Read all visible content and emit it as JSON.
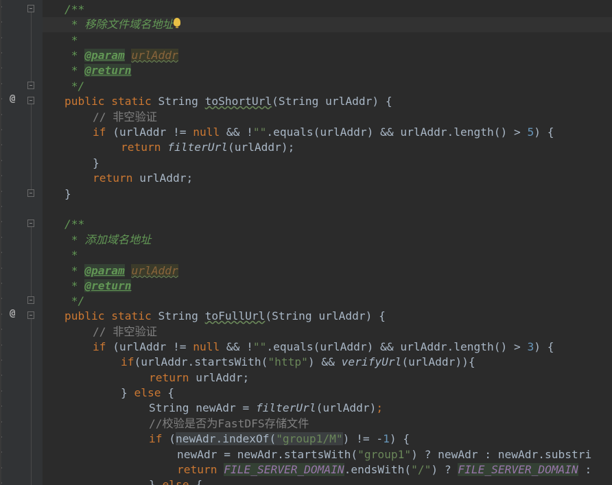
{
  "editor": {
    "lines": {
      "l1": "/**",
      "l2": " * 移除文件域名地址",
      "l3": " *",
      "l4_star": " * ",
      "l4_tag": "@param",
      "l4_name": "urlAddr",
      "l5_star": " * ",
      "l5_tag": "@return",
      "l6": " */",
      "l7_kw": "public static",
      "l7_type": " String ",
      "l7_name": "toShortUrl",
      "l7_rest": "(String urlAddr) {",
      "l8": "// 非空验证",
      "l9_kw1": "if",
      "l9_a": " (urlAddr != ",
      "l9_kw2": "null",
      "l9_b": " && !",
      "l9_str": "\"\"",
      "l9_c": ".equals(urlAddr) && urlAddr.length() > ",
      "l9_num": "5",
      "l9_d": ") {",
      "l10_kw": "return",
      "l10_fn": " filterUrl",
      "l10_rest": "(urlAddr);",
      "l11": "}",
      "l12_kw": "return",
      "l12_rest": " urlAddr;",
      "l13": "}",
      "l15": "/**",
      "l16": " * 添加域名地址",
      "l17": " *",
      "l18_star": " * ",
      "l18_tag": "@param",
      "l18_name": "urlAddr",
      "l19_star": " * ",
      "l19_tag": "@return",
      "l20": " */",
      "l21_kw": "public static",
      "l21_type": " String ",
      "l21_name": "toFullUrl",
      "l21_rest": "(String urlAddr) {",
      "l22": "// 非空验证",
      "l23_kw1": "if",
      "l23_a": " (urlAddr != ",
      "l23_kw2": "null",
      "l23_b": " && !",
      "l23_str": "\"\"",
      "l23_c": ".equals(urlAddr) && urlAddr.length() > ",
      "l23_num": "3",
      "l23_d": ") {",
      "l24_kw": "if",
      "l24_a": "(urlAddr.startsWith(",
      "l24_str": "\"http\"",
      "l24_b": ") && ",
      "l24_fn": "verifyUrl",
      "l24_c": "(urlAddr)){",
      "l25_kw": "return",
      "l25_rest": " urlAddr;",
      "l26_a": "} ",
      "l26_kw": "else",
      "l26_b": " {",
      "l27_a": "String newAdr = ",
      "l27_fn": "filterUrl",
      "l27_b": "(urlAddr)",
      "l27_semi": ";",
      "l28": "//校验是否为FastDFS存储文件",
      "l29_kw": "if",
      "l29_a": " (",
      "l29_hl": "newAdr.indexOf(",
      "l29_str": "\"group1/M\"",
      "l29_b": ") != -",
      "l29_num": "1",
      "l29_c": ") {",
      "l30_a": "newAdr = newAdr.startsWith(",
      "l30_str": "\"group1\"",
      "l30_b": ") ? newAdr : newAdr.substri",
      "l31_kw": "return",
      "l31_c1": "FILE_SERVER_DOMAIN",
      "l31_a": ".endsWith(",
      "l31_str": "\"/\"",
      "l31_b": ") ? ",
      "l31_c2": "FILE_SERVER_DOMAIN",
      "l31_c": " :",
      "l32_a": "} ",
      "l32_kw": "else",
      "l32_b": " {"
    },
    "gutter_icons": [
      "fold-icon",
      "override-at-icon",
      "intention-bulb-icon"
    ]
  }
}
